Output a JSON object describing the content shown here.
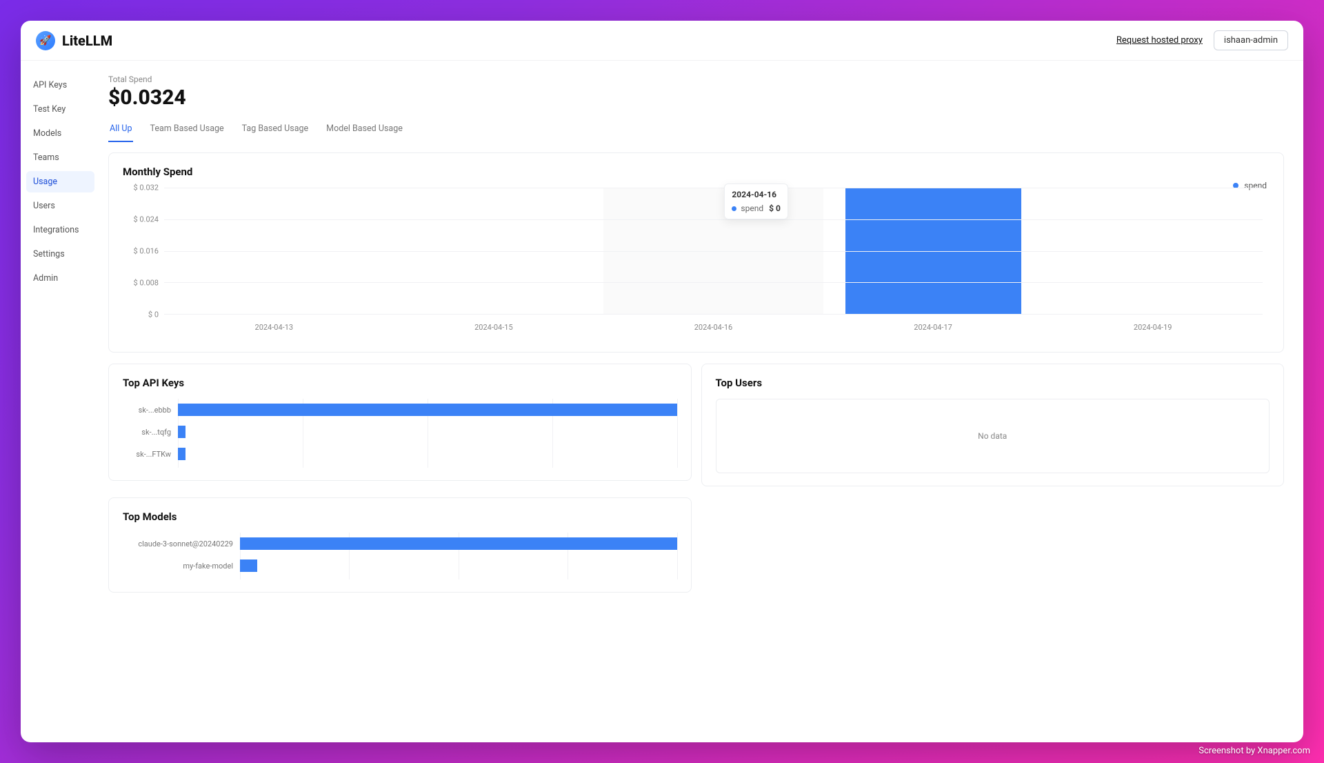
{
  "brand": {
    "name": "LiteLLM",
    "logo_glyph": "🚀"
  },
  "header": {
    "hosted_link_label": "Request hosted proxy",
    "user_label": "ishaan-admin"
  },
  "sidebar": {
    "items": [
      {
        "label": "API Keys"
      },
      {
        "label": "Test Key"
      },
      {
        "label": "Models"
      },
      {
        "label": "Teams"
      },
      {
        "label": "Usage"
      },
      {
        "label": "Users"
      },
      {
        "label": "Integrations"
      },
      {
        "label": "Settings"
      },
      {
        "label": "Admin"
      }
    ],
    "active_index": 4
  },
  "total_spend": {
    "label": "Total Spend",
    "value": "$0.0324"
  },
  "tabs": {
    "items": [
      {
        "label": "All Up"
      },
      {
        "label": "Team Based Usage"
      },
      {
        "label": "Tag Based Usage"
      },
      {
        "label": "Model Based Usage"
      }
    ],
    "active_index": 0
  },
  "monthly": {
    "title": "Monthly Spend",
    "legend_label": "spend",
    "tooltip": {
      "date": "2024-04-16",
      "series": "spend",
      "value": "$ 0"
    }
  },
  "cards": {
    "top_api_keys_title": "Top API Keys",
    "top_users_title": "Top Users",
    "top_users_nodata": "No data",
    "top_models_title": "Top Models"
  },
  "watermark": "Screenshot by Xnapper.com",
  "chart_data": [
    {
      "id": "monthly_spend",
      "type": "bar",
      "title": "Monthly Spend",
      "xlabel": "",
      "ylabel": "",
      "ylim": [
        0,
        0.032
      ],
      "y_ticks": [
        "$ 0.032",
        "$ 0.024",
        "$ 0.016",
        "$ 0.008",
        "$ 0"
      ],
      "categories": [
        "2024-04-13",
        "2024-04-15",
        "2024-04-16",
        "2024-04-17",
        "2024-04-19"
      ],
      "series": [
        {
          "name": "spend",
          "values": [
            0,
            0,
            0,
            0.0324,
            0
          ]
        }
      ],
      "hover_index": 2
    },
    {
      "id": "top_api_keys",
      "type": "bar",
      "orientation": "horizontal",
      "title": "Top API Keys",
      "categories": [
        "sk-...ebbb",
        "sk-...tqfg",
        "sk-...FTKw"
      ],
      "values_relative": [
        1.0,
        0.015,
        0.015
      ],
      "xlim": [
        0,
        1
      ]
    },
    {
      "id": "top_models",
      "type": "bar",
      "orientation": "horizontal",
      "title": "Top Models",
      "categories": [
        "claude-3-sonnet@20240229",
        "my-fake-model"
      ],
      "values_relative": [
        1.0,
        0.04
      ],
      "xlim": [
        0,
        1
      ]
    }
  ]
}
